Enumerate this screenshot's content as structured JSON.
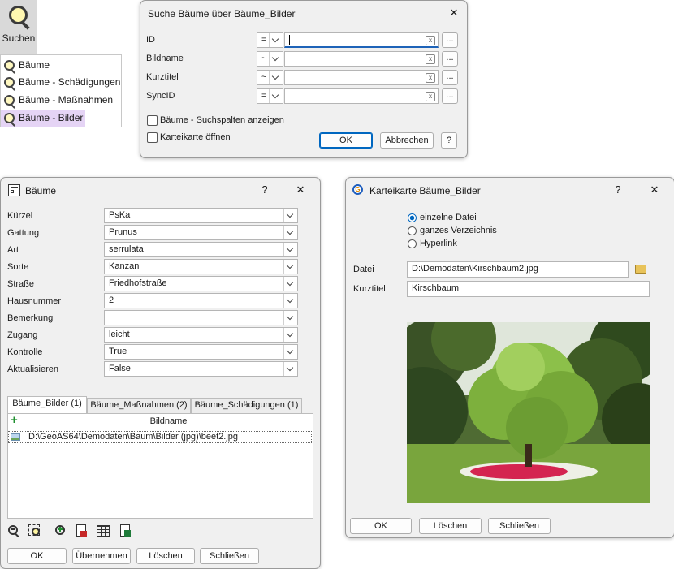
{
  "ribbon": {
    "search_label": "Suchen",
    "menu": [
      {
        "label": "Bäume"
      },
      {
        "label": "Bäume - Schädigungen"
      },
      {
        "label": "Bäume - Maßnahmen"
      },
      {
        "label": "Bäume - Bilder"
      }
    ]
  },
  "search_dialog": {
    "title": "Suche Bäume über Bäume_Bilder",
    "rows": [
      {
        "label": "ID",
        "op": "=",
        "value": ""
      },
      {
        "label": "Bildname",
        "op": "~",
        "value": ""
      },
      {
        "label": "Kurztitel",
        "op": "~",
        "value": ""
      },
      {
        "label": "SyncID",
        "op": "=",
        "value": ""
      }
    ],
    "dots": "...",
    "clear": "x",
    "check_columns": "Bäume - Suchspalten anzeigen",
    "check_card": "Karteikarte öffnen",
    "ok": "OK",
    "cancel": "Abbrechen",
    "help": "?",
    "close": "✕"
  },
  "baeume_dialog": {
    "title": "Bäume",
    "help": "?",
    "close": "✕",
    "fields": [
      {
        "label": "Kürzel",
        "value": "PsKa"
      },
      {
        "label": "Gattung",
        "value": "Prunus"
      },
      {
        "label": "Art",
        "value": "serrulata"
      },
      {
        "label": "Sorte",
        "value": "Kanzan"
      },
      {
        "label": "Straße",
        "value": "Friedhofstraße"
      },
      {
        "label": "Hausnummer",
        "value": "2"
      },
      {
        "label": "Bemerkung",
        "value": ""
      },
      {
        "label": "Zugang",
        "value": "leicht"
      },
      {
        "label": "Kontrolle",
        "value": "True"
      },
      {
        "label": "Aktualisieren",
        "value": "False"
      }
    ],
    "tabs": [
      "Bäume_Bilder (1)",
      "Bäume_Maßnahmen (2)",
      "Bäume_Schädigungen (1)"
    ],
    "grid_header": "Bildname",
    "grid_add": "+",
    "grid_rows": [
      "D:\\GeoAS64\\Demodaten\\Baum\\Bilder (jpg)\\beet2.jpg"
    ],
    "buttons": {
      "ok": "OK",
      "apply": "Übernehmen",
      "delete": "Löschen",
      "close": "Schließen"
    }
  },
  "card_dialog": {
    "title": "Karteikarte Bäume_Bilder",
    "help": "?",
    "close": "✕",
    "radios": [
      {
        "label": "einzelne Datei",
        "checked": true
      },
      {
        "label": "ganzes Verzeichnis",
        "checked": false
      },
      {
        "label": "Hyperlink",
        "checked": false
      }
    ],
    "file_label": "Datei",
    "file_value": "D:\\Demodaten\\Kirschbaum2.jpg",
    "title_label": "Kurztitel",
    "title_value": "Kirschbaum",
    "buttons": {
      "ok": "OK",
      "delete": "Löschen",
      "close": "Schließen"
    }
  },
  "colors": {
    "accent": "#0067c0",
    "menu_highlight": "#e5d4f5",
    "ribbon_bg": "#d6d6d6"
  }
}
